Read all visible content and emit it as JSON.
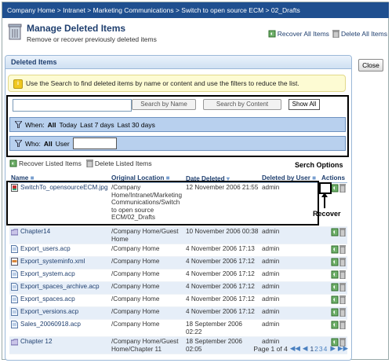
{
  "breadcrumb": "Company Home > Intranet > Marketing Communications > Switch to open source ECM > 02_Drafts",
  "header": {
    "title": "Manage Deleted Items",
    "subtitle": "Remove or recover previously deleted items",
    "recover_all": "Recover All Items",
    "delete_all": "Delete All Items"
  },
  "close_label": "Close",
  "panel_title": "Deleted Items",
  "info_text": "Use the Search to find deleted items by name or content and use the filters to reduce the list.",
  "search": {
    "value": "",
    "by_name": "Search by Name",
    "by_content": "Search by Content",
    "show_all": "Show All"
  },
  "filters": {
    "when_label": "When:",
    "when_all": "All",
    "when_today": "Today",
    "when_7": "Last 7 days",
    "when_30": "Last 30 days",
    "who_label": "Who:",
    "who_all": "All",
    "who_user": "User",
    "who_value": ""
  },
  "list_actions": {
    "recover": "Recover Listed Items",
    "delete": "Delete Listed Items"
  },
  "annotations": {
    "serch_options": "Serch Options",
    "recover": "Recover"
  },
  "columns": {
    "name": "Name",
    "location": "Original Location",
    "date": "Date Deleted",
    "user": "Deleted by User",
    "actions": "Actions"
  },
  "rows": [
    {
      "name": "SwitchTo_opensourceECM.jpg",
      "location": "/Company Home/Intranet/Marketing Communications/Switch to open source ECM/02_Drafts",
      "date": "12 November 2006 21:55",
      "user": "admin",
      "icon": "image-file-icon"
    },
    {
      "name": "Chapter14",
      "location": "/Company Home/Guest Home",
      "date": "10 November 2006 00:38",
      "user": "admin",
      "icon": "folder-icon"
    },
    {
      "name": "Export_users.acp",
      "location": "/Company Home",
      "date": "4 November 2006 17:13",
      "user": "admin",
      "icon": "file-icon"
    },
    {
      "name": "Export_systeminfo.xml",
      "location": "/Company Home",
      "date": "4 November 2006 17:12",
      "user": "admin",
      "icon": "xml-file-icon"
    },
    {
      "name": "Export_system.acp",
      "location": "/Company Home",
      "date": "4 November 2006 17:12",
      "user": "admin",
      "icon": "file-icon"
    },
    {
      "name": "Export_spaces_archive.acp",
      "location": "/Company Home",
      "date": "4 November 2006 17:12",
      "user": "admin",
      "icon": "file-icon"
    },
    {
      "name": "Export_spaces.acp",
      "location": "/Company Home",
      "date": "4 November 2006 17:12",
      "user": "admin",
      "icon": "file-icon"
    },
    {
      "name": "Export_versions.acp",
      "location": "/Company Home",
      "date": "4 November 2006 17:12",
      "user": "admin",
      "icon": "file-icon"
    },
    {
      "name": "Sales_20060918.acp",
      "location": "/Company Home",
      "date": "18 September 2006 02:22",
      "user": "admin",
      "icon": "file-icon"
    },
    {
      "name": "Chapter 12",
      "location": "/Company Home/Guest Home/Chapter 11",
      "date": "18 September 2006 02:05",
      "user": "admin",
      "icon": "folder-icon"
    }
  ],
  "pager": {
    "label": "Page 1 of 4",
    "pages": [
      "1",
      "2",
      "3",
      "4"
    ]
  },
  "colors": {
    "accent": "#1f4f8f",
    "filter_bg": "#b8d0ee",
    "info_bg": "#fdfbd3"
  }
}
